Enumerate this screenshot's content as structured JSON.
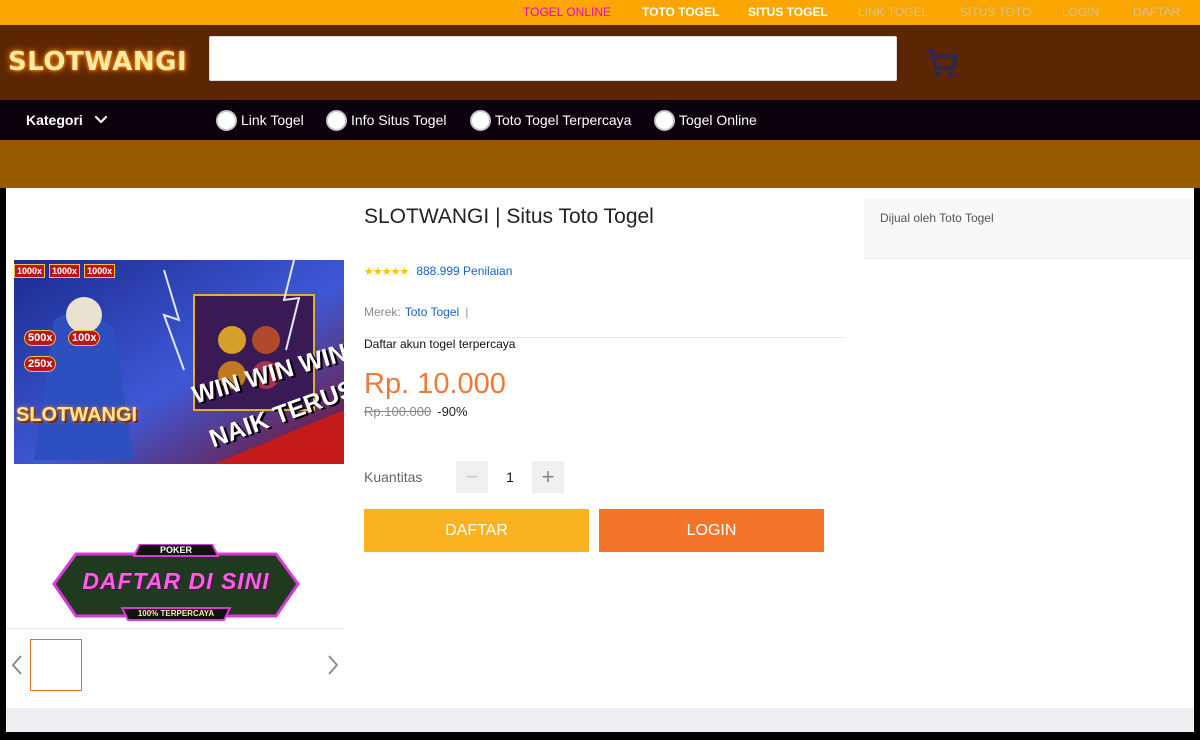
{
  "topbar": {
    "links": [
      "TOGEL ONLINE",
      "TOTO TOGEL",
      "SITUS TOGEL",
      "LINK TOGEL",
      "SITUS TOTO",
      "LOGIN",
      "DAFTAR"
    ]
  },
  "header": {
    "logo_text": "SLOTWANGI",
    "search_value": "",
    "cart_icon": "cart-icon"
  },
  "nav": {
    "kategori_label": "Kategori",
    "items": [
      "Link Togel",
      "Info Situs Togel",
      "Toto Togel Terpercaya",
      "Togel Online"
    ]
  },
  "gallery": {
    "main_image_text": [
      "SLOTWANGI",
      "WIN WIN WIN",
      "NAIK TERUS"
    ],
    "multipliers": [
      "1000x",
      "1000x",
      "1000x",
      "500x",
      "100x",
      "250x"
    ],
    "promo": {
      "top": "POKER",
      "main": "DAFTAR DI SINI",
      "bottom": "100% TERPERCAYA"
    }
  },
  "product": {
    "title": "SLOTWANGI | Situs Toto Togel",
    "stars": "★★★★★",
    "reviews": "888.999 Penilaian",
    "brand_label": "Merek:",
    "brand_value": "Toto Togel",
    "brand_sep": "|",
    "description": "Daftar akun togel terpercaya",
    "price": "Rp. 10.000",
    "old_price": "Rp.100.000",
    "discount": "-90%",
    "quantity_label": "Kuantitas",
    "quantity_value": "1",
    "buttons": {
      "daftar": "DAFTAR",
      "login": "LOGIN"
    }
  },
  "seller": {
    "label": "Dijual oleh Toto Togel"
  },
  "colors": {
    "topbar": "#fba500",
    "header": "#5c2605",
    "nav": "#0b000b",
    "band": "#9a5a00",
    "price": "#ef7a36",
    "daftar": "#fbb220",
    "login": "#f47529",
    "link": "#1463c8"
  }
}
